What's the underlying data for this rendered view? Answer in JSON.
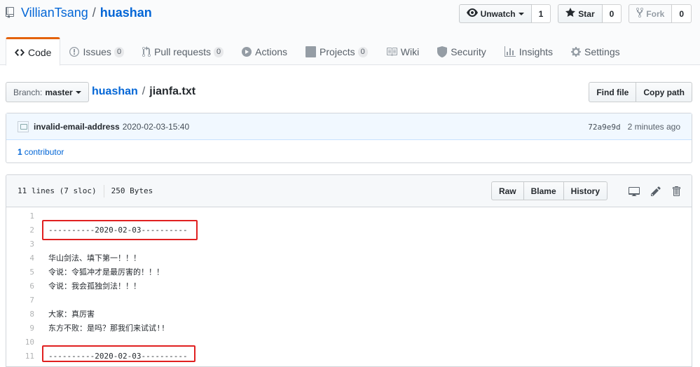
{
  "header": {
    "owner": "VillianTsang",
    "separator": "/",
    "repo": "huashan",
    "watch": {
      "label": "Unwatch",
      "count": "1"
    },
    "star": {
      "label": "Star",
      "count": "0"
    },
    "fork": {
      "label": "Fork",
      "count": "0"
    }
  },
  "tabs": [
    {
      "label": "Code",
      "counter": ""
    },
    {
      "label": "Issues",
      "counter": "0"
    },
    {
      "label": "Pull requests",
      "counter": "0"
    },
    {
      "label": "Actions",
      "counter": ""
    },
    {
      "label": "Projects",
      "counter": "0"
    },
    {
      "label": "Wiki",
      "counter": ""
    },
    {
      "label": "Security",
      "counter": ""
    },
    {
      "label": "Insights",
      "counter": ""
    },
    {
      "label": "Settings",
      "counter": ""
    }
  ],
  "branch": {
    "prefix": "Branch:",
    "name": "master"
  },
  "breadcrumb": {
    "repo": "huashan",
    "sep": "/",
    "file": "jianfa.txt"
  },
  "path_buttons": {
    "find": "Find file",
    "copy": "Copy path"
  },
  "commit": {
    "author": "invalid-email-address",
    "message": "2020-02-03-15:40",
    "sha": "72a9e9d",
    "time": "2 minutes ago",
    "contributors_count": "1",
    "contributors_label": "contributor"
  },
  "file": {
    "lines_info": "11 lines (7 sloc)",
    "size": "250 Bytes",
    "raw": "Raw",
    "blame": "Blame",
    "history": "History"
  },
  "lines": [
    {
      "n": "1",
      "text": ""
    },
    {
      "n": "2",
      "text": "----------2020-02-03----------"
    },
    {
      "n": "3",
      "text": ""
    },
    {
      "n": "4",
      "text": "华山剑法、填下第一！！！"
    },
    {
      "n": "5",
      "text": "令说：令狐冲才是最厉害的！！！"
    },
    {
      "n": "6",
      "text": "令说：我会孤独剑法！！！"
    },
    {
      "n": "7",
      "text": ""
    },
    {
      "n": "8",
      "text": "大家：真厉害"
    },
    {
      "n": "9",
      "text": "东方不败：是吗？那我们来试试!!"
    },
    {
      "n": "10",
      "text": ""
    },
    {
      "n": "11",
      "text": "----------2020-02-03----------"
    }
  ],
  "colors": {
    "link": "#0366d6",
    "highlight": "#e02020",
    "tab_accent": "#e36209"
  }
}
